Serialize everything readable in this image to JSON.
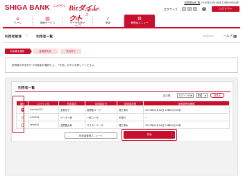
{
  "header": {
    "bank_name": "SHIGA BANK",
    "service_small": "しがぎん",
    "service_main": "Bizダイレクト",
    "service_sub": "Lightコース",
    "user_name": "滋賀銀太郎 様",
    "last_login": "2010年04月18日 10時00分00秒",
    "text_size_label": "文字サイズ",
    "size_small": "小",
    "size_medium": "中",
    "size_large": "大",
    "help_icon_label": "?",
    "logout_label": "ログアウト"
  },
  "nav": {
    "items": [
      {
        "label": "ホーム",
        "icon": "home-icon",
        "glyph": "⌂"
      },
      {
        "label": "明細サービス",
        "icon": "document-icon",
        "glyph": "▤"
      },
      {
        "label": "データ伝送サービス",
        "icon": "transfer-icon",
        "glyph": "⇄"
      },
      {
        "label": "承認",
        "icon": "approval-icon",
        "glyph": "✓"
      },
      {
        "label": "管理者メニュー",
        "icon": "admin-icon",
        "glyph": "⚙"
      }
    ],
    "active_index": 4
  },
  "page": {
    "section": "利用者管理",
    "arrow": "›",
    "title": "利用者一覧",
    "screen_id": "BRSK019",
    "help_label": "ヘルプ",
    "help_icon": "?"
  },
  "steps": [
    {
      "label": "利用者を選択"
    },
    {
      "label": "証明書失効"
    },
    {
      "label": "失効完了"
    }
  ],
  "steps_current_index": 0,
  "instruction": "証明書の失効を行う利用者を選択の上、「失効」ボタンを押してください。",
  "user_list": {
    "title": "利用者一覧",
    "sort_label": "並び順：",
    "sort_key": "ログインID",
    "sort_order": "昇順",
    "sort_button": "再表示",
    "caret": "▼",
    "columns": [
      "選択",
      "ログインID",
      "利用者名",
      "利用者区分",
      "証明書状態",
      "証明書有効期限"
    ],
    "rows": [
      {
        "login_id": "haneko001",
        "name": "滋賀花子",
        "type": "管理者ユーザ",
        "cert_status": "発行済み",
        "expiry": "2010年04月18日 10時00分00秒",
        "selectable": true,
        "checked": true
      },
      {
        "login_id": "ichiro01",
        "name": "データ一郎",
        "type": "一般ユーザ",
        "cert_status": "未発行",
        "expiry": "－",
        "selectable": false,
        "checked": false
      },
      {
        "login_id": "taro001",
        "name": "滋賀銀太郎",
        "type": "マスターユーザ",
        "cert_status": "発行済み",
        "expiry": "2010年04月18日 10時00分00秒",
        "selectable": true,
        "checked": false
      }
    ]
  },
  "buttons": {
    "back": "利用者管理メニューへ",
    "back_chevron": "‹",
    "revoke": "失効",
    "revoke_chevron": "›"
  },
  "colors": {
    "accent": "#c8102e",
    "panel_bg": "#f2f2f2"
  }
}
